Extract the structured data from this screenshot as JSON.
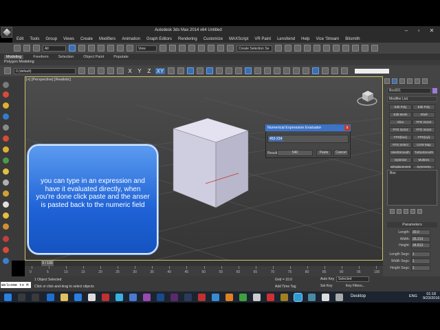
{
  "window": {
    "title": "Autodesk 3ds Max 2014 x64      Untitled",
    "controls": [
      "–",
      "▫",
      "✕"
    ]
  },
  "menu": [
    "Edit",
    "Tools",
    "Group",
    "Views",
    "Create",
    "Modifiers",
    "Animation",
    "Graph Editors",
    "Rendering",
    "Customize",
    "MAXScript",
    "VR Paint",
    "Lensfeind",
    "Help",
    "Vice 'Stream",
    "Bitsmith"
  ],
  "toolbar": {
    "selection_filter": "All",
    "reference_coord": "View",
    "named_selection": "Create Selection Se"
  },
  "ribbon": {
    "tabs": [
      "Modeling",
      "Freeform",
      "Selection",
      "Object Paint",
      "Populate"
    ],
    "active_tab": "Modeling",
    "sub_label": "Polygon Modeling"
  },
  "toolbar2": {
    "layer": "0 (default)",
    "axes": [
      "X",
      "Y",
      "Z",
      "XY"
    ]
  },
  "viewport": {
    "label": "[+] [Perspective] [Realistic]"
  },
  "dialog": {
    "title": "Numerical Expression Evaluator",
    "close": "x",
    "expression": "452-234",
    "result_label": "Result:",
    "result_value": "540",
    "paste_label": "Paste",
    "cancel_label": "Cancel"
  },
  "tooltip": {
    "text": "you can type in an expression and have it evaluated directly, when you're done click paste and the anser is pasted back to the numeric field"
  },
  "command_panel": {
    "object_name": "Box001",
    "object_color": "#9b7bd6",
    "modifier_list": "Modifier List",
    "modifier_buttons": [
      [
        "Edit Poly",
        "Edit Poly"
      ],
      [
        "Edit Mesh",
        "Shell"
      ],
      [
        "Slice",
        "FFD 2x2x2"
      ],
      [
        "FFD 3x3x3",
        "FFD 4x4x4"
      ],
      [
        "FFD(box)",
        "FFD(cyl)"
      ],
      [
        "FFD Select",
        "UVW Map"
      ],
      [
        "MeshSmooth",
        "TurboSmooth"
      ],
      [
        "Optimize",
        "Multires"
      ],
      [
        "vDisplacement",
        "Symmetry"
      ]
    ],
    "stack_item": "Box",
    "params_title": "Parameters",
    "params": [
      {
        "label": "Length:",
        "value": "30.0"
      },
      {
        "label": "Width:",
        "value": "26.213"
      },
      {
        "label": "Height:",
        "value": "34.813"
      },
      {
        "label": "Length Segs:",
        "value": "1"
      },
      {
        "label": "Width Segs:",
        "value": "1"
      },
      {
        "label": "Height Segs:",
        "value": "1"
      }
    ]
  },
  "timeline": {
    "frame_label": "0 / 100",
    "ticks": [
      "0",
      "5",
      "10",
      "15",
      "20",
      "25",
      "30",
      "35",
      "40",
      "45",
      "50",
      "55",
      "60",
      "65",
      "70",
      "75",
      "80",
      "85",
      "90",
      "95",
      "100"
    ]
  },
  "status": {
    "maxscript": "Welcome to M",
    "line1": "1 Object Selected",
    "line2": "Click or click-and-drag to select objects",
    "grid": "Grid = 10.0",
    "add_time_tag": "Add Time Tag",
    "auto_key": "Auto Key",
    "selected": "Selected",
    "set_key": "Set Key",
    "key_filters": "Key Filters..."
  },
  "taskbar": {
    "desktop": "Desktop",
    "lang": "ENG",
    "time": "01:18",
    "date": "9/23/2016"
  },
  "colors": {
    "accent": "#3d73c7",
    "tooltip": "#1e62d6",
    "viewport_border": "#cfc56a"
  }
}
